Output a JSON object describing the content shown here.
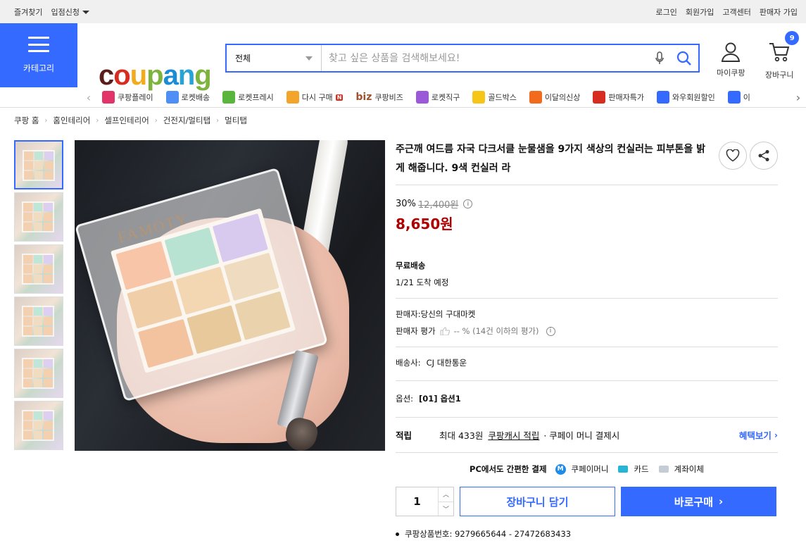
{
  "topbar": {
    "bookmark": "즐겨찾기",
    "partner": "입점신청",
    "links": [
      "로그인",
      "회원가입",
      "고객센터",
      "판매자 가입"
    ]
  },
  "header": {
    "category_label": "카테고리",
    "logo": {
      "text": "coupang",
      "colors": [
        "#5b1d1a",
        "#d62d20",
        "#f2ab1a",
        "#7eb33e",
        "#1d8cd6",
        "#27a3d6",
        "#7eb33e"
      ]
    },
    "search": {
      "scope": "전체",
      "placeholder": "찾고 싶은 상품을 검색해보세요!"
    },
    "mycoupang": "마이쿠팡",
    "cart": "장바구니",
    "cart_count": "9"
  },
  "catnav": {
    "items": [
      {
        "label": "쿠팡플레이",
        "icon": "play-icon",
        "color": "#e2336b"
      },
      {
        "label": "로켓배송",
        "icon": "rocket-icon",
        "color": "#4f8ef5"
      },
      {
        "label": "로켓프레시",
        "icon": "rocket-fresh-icon",
        "color": "#57b63b"
      },
      {
        "label": "다시 구매",
        "icon": "repurchase-icon",
        "color": "#f3a42a",
        "tag": "N"
      },
      {
        "label": "쿠팡비즈",
        "icon": "biz-icon",
        "color": "#a0522d",
        "prefix": "biz"
      },
      {
        "label": "로켓직구",
        "icon": "global-rocket-icon",
        "color": "#9b59d9"
      },
      {
        "label": "골드박스",
        "icon": "goldbox-icon",
        "color": "#f5c518"
      },
      {
        "label": "이달의신상",
        "icon": "new-bag-icon",
        "color": "#f26b1d"
      },
      {
        "label": "판매자특가",
        "icon": "percent-icon",
        "color": "#d62d20"
      },
      {
        "label": "와우회원할인",
        "icon": "wow-icon",
        "color": "#346aff"
      },
      {
        "label": "이",
        "icon": "coupon-icon",
        "color": "#346aff"
      }
    ]
  },
  "breadcrumb": [
    "쿠팡 홈",
    "홈인테리어",
    "셀프인테리어",
    "건전지/멀티탭",
    "멀티탭"
  ],
  "product": {
    "image_brand": "FAMOTY",
    "title": "주근깨 여드름 자국 다크서클 눈물샘을 9가지 색상의 컨실러는 피부톤을 밝게 해줍니다. 9색 컨실러 라",
    "discount": "30%",
    "original_price": "12,400원",
    "price": "8,650원",
    "shipping_label": "무료배송",
    "arrival": "1/21 도착 예정",
    "seller": "판매자:당신의 구대마켓",
    "rating_label": "판매자 평가",
    "rating_value": "-- % (14건 이하의 평가)",
    "courier_label": "배송사:",
    "courier": "CJ 대한통운",
    "option_label": "옵션:",
    "option": "[01] 옵션1",
    "reward_label": "적립",
    "reward_text": "최대 433원",
    "reward_link": "쿠팡캐시 적립",
    "reward_tail": "· 쿠페이 머니 결제시",
    "benefit_link": "혜택보기",
    "pay_title": "PC에서도 간편한 결제",
    "pay_methods": [
      "쿠페이머니",
      "카드",
      "계좌이체"
    ],
    "quantity": "1",
    "cart_button": "장바구니 담기",
    "buy_button": "바로구매",
    "product_id": "쿠팡상품번호: 9279665644 - 27472683433"
  }
}
